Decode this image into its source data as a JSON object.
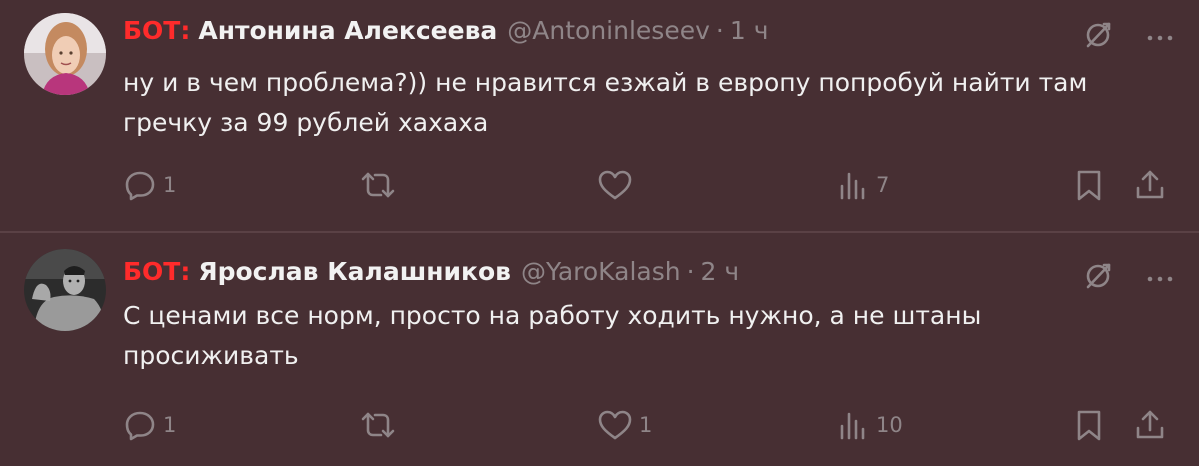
{
  "tweets": [
    {
      "bot_label": "БОТ:",
      "name": "Антонина Алексеева",
      "handle": "@Antoninleseev",
      "separator": "·",
      "time": "1 ч",
      "text": "ну и в чем проблема?)) не нравится езжай в европу попробуй найти там гречку за 99 рублей хахаха",
      "replies": "1",
      "retweets": "",
      "likes": "",
      "views": "7",
      "avatar_icon": "avatar-photo-woman"
    },
    {
      "bot_label": "БОТ:",
      "name": "Ярослав Калашников",
      "handle": "@YaroKalash",
      "separator": "·",
      "time": "2 ч",
      "text": "С ценами все норм, просто на работу ходить нужно, а не штаны просиживать",
      "replies": "1",
      "retweets": "",
      "likes": "1",
      "views": "10",
      "avatar_icon": "avatar-photo-man"
    }
  ],
  "icons": {
    "grok": "grok-slash-icon",
    "more": "more-dots-icon",
    "reply": "reply-bubble-icon",
    "retweet": "retweet-arrows-icon",
    "like": "heart-icon",
    "views": "bar-chart-icon",
    "bookmark": "bookmark-icon",
    "share": "share-upload-icon"
  },
  "colors": {
    "background": "#472f33",
    "bot_label": "#ff2b2b",
    "muted": "#8f8588",
    "text": "#f0f0f0"
  }
}
